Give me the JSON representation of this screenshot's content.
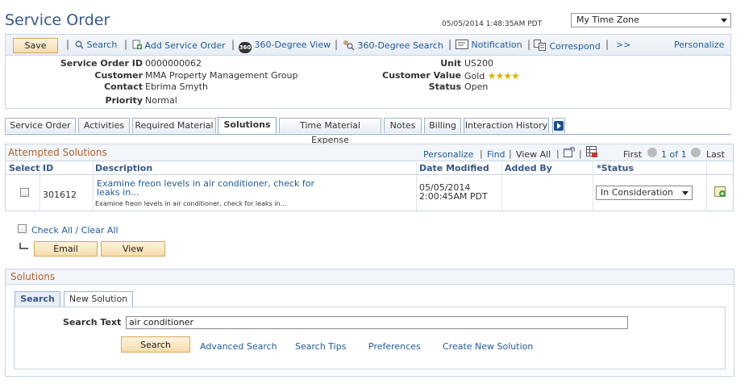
{
  "page": {
    "title": "Service Order",
    "datetime": "05/05/2014 1:48:35AM PDT",
    "timezone": "My Time Zone"
  },
  "toolbar": {
    "save": "Save",
    "search": "Search",
    "add_service_order": "Add Service Order",
    "view_360": "360-Degree View",
    "search_360": "360-Degree Search",
    "notification": "Notification",
    "correspond": "Correspond",
    "more": ">>",
    "personalize": "Personalize",
    "badge_360": "360"
  },
  "header": {
    "service_order_id_label": "Service Order ID",
    "service_order_id": "0000000062",
    "customer_label": "Customer",
    "customer": "MMA Property Management Group",
    "contact_label": "Contact",
    "contact": "Ebrima Smyth",
    "priority_label": "Priority",
    "priority": "Normal",
    "unit_label": "Unit",
    "unit": "US200",
    "customer_value_label": "Customer Value",
    "customer_value": "Gold",
    "customer_value_stars": 4,
    "status_label": "Status",
    "status": "Open"
  },
  "tabs": [
    "Service Order",
    "Activities",
    "Required Material",
    "Solutions",
    "Time Material Expense",
    "Notes",
    "Billing",
    "Interaction History"
  ],
  "active_tab": "Solutions",
  "attempted": {
    "title": "Attempted Solutions",
    "personalize": "Personalize",
    "find": "Find",
    "view_all": "View All",
    "first": "First",
    "range": "1 of 1",
    "last": "Last",
    "columns": {
      "select": "Select",
      "id": "ID",
      "description": "Description",
      "date_modified": "Date Modified",
      "added_by": "Added By",
      "status": "*Status"
    },
    "rows": [
      {
        "id": "301612",
        "description_line1": "Examine freon levels in air conditioner, check for",
        "description_line2": "leaks in...",
        "description_detail": "Examine freon levels in air conditioner, check for leaks in...",
        "date": "05/05/2014",
        "time": "2:00:45AM PDT",
        "added_by": "",
        "status": "In Consideration"
      }
    ],
    "check_all": "Check All / Clear All",
    "email": "Email",
    "view": "View"
  },
  "solutions": {
    "title": "Solutions",
    "tab_search": "Search",
    "tab_new": "New Solution",
    "search_text_label": "Search Text",
    "search_text_value": "air conditioner",
    "search_button": "Search",
    "advanced_search": "Advanced Search",
    "search_tips": "Search Tips",
    "preferences": "Preferences",
    "create_new": "Create New Solution"
  }
}
